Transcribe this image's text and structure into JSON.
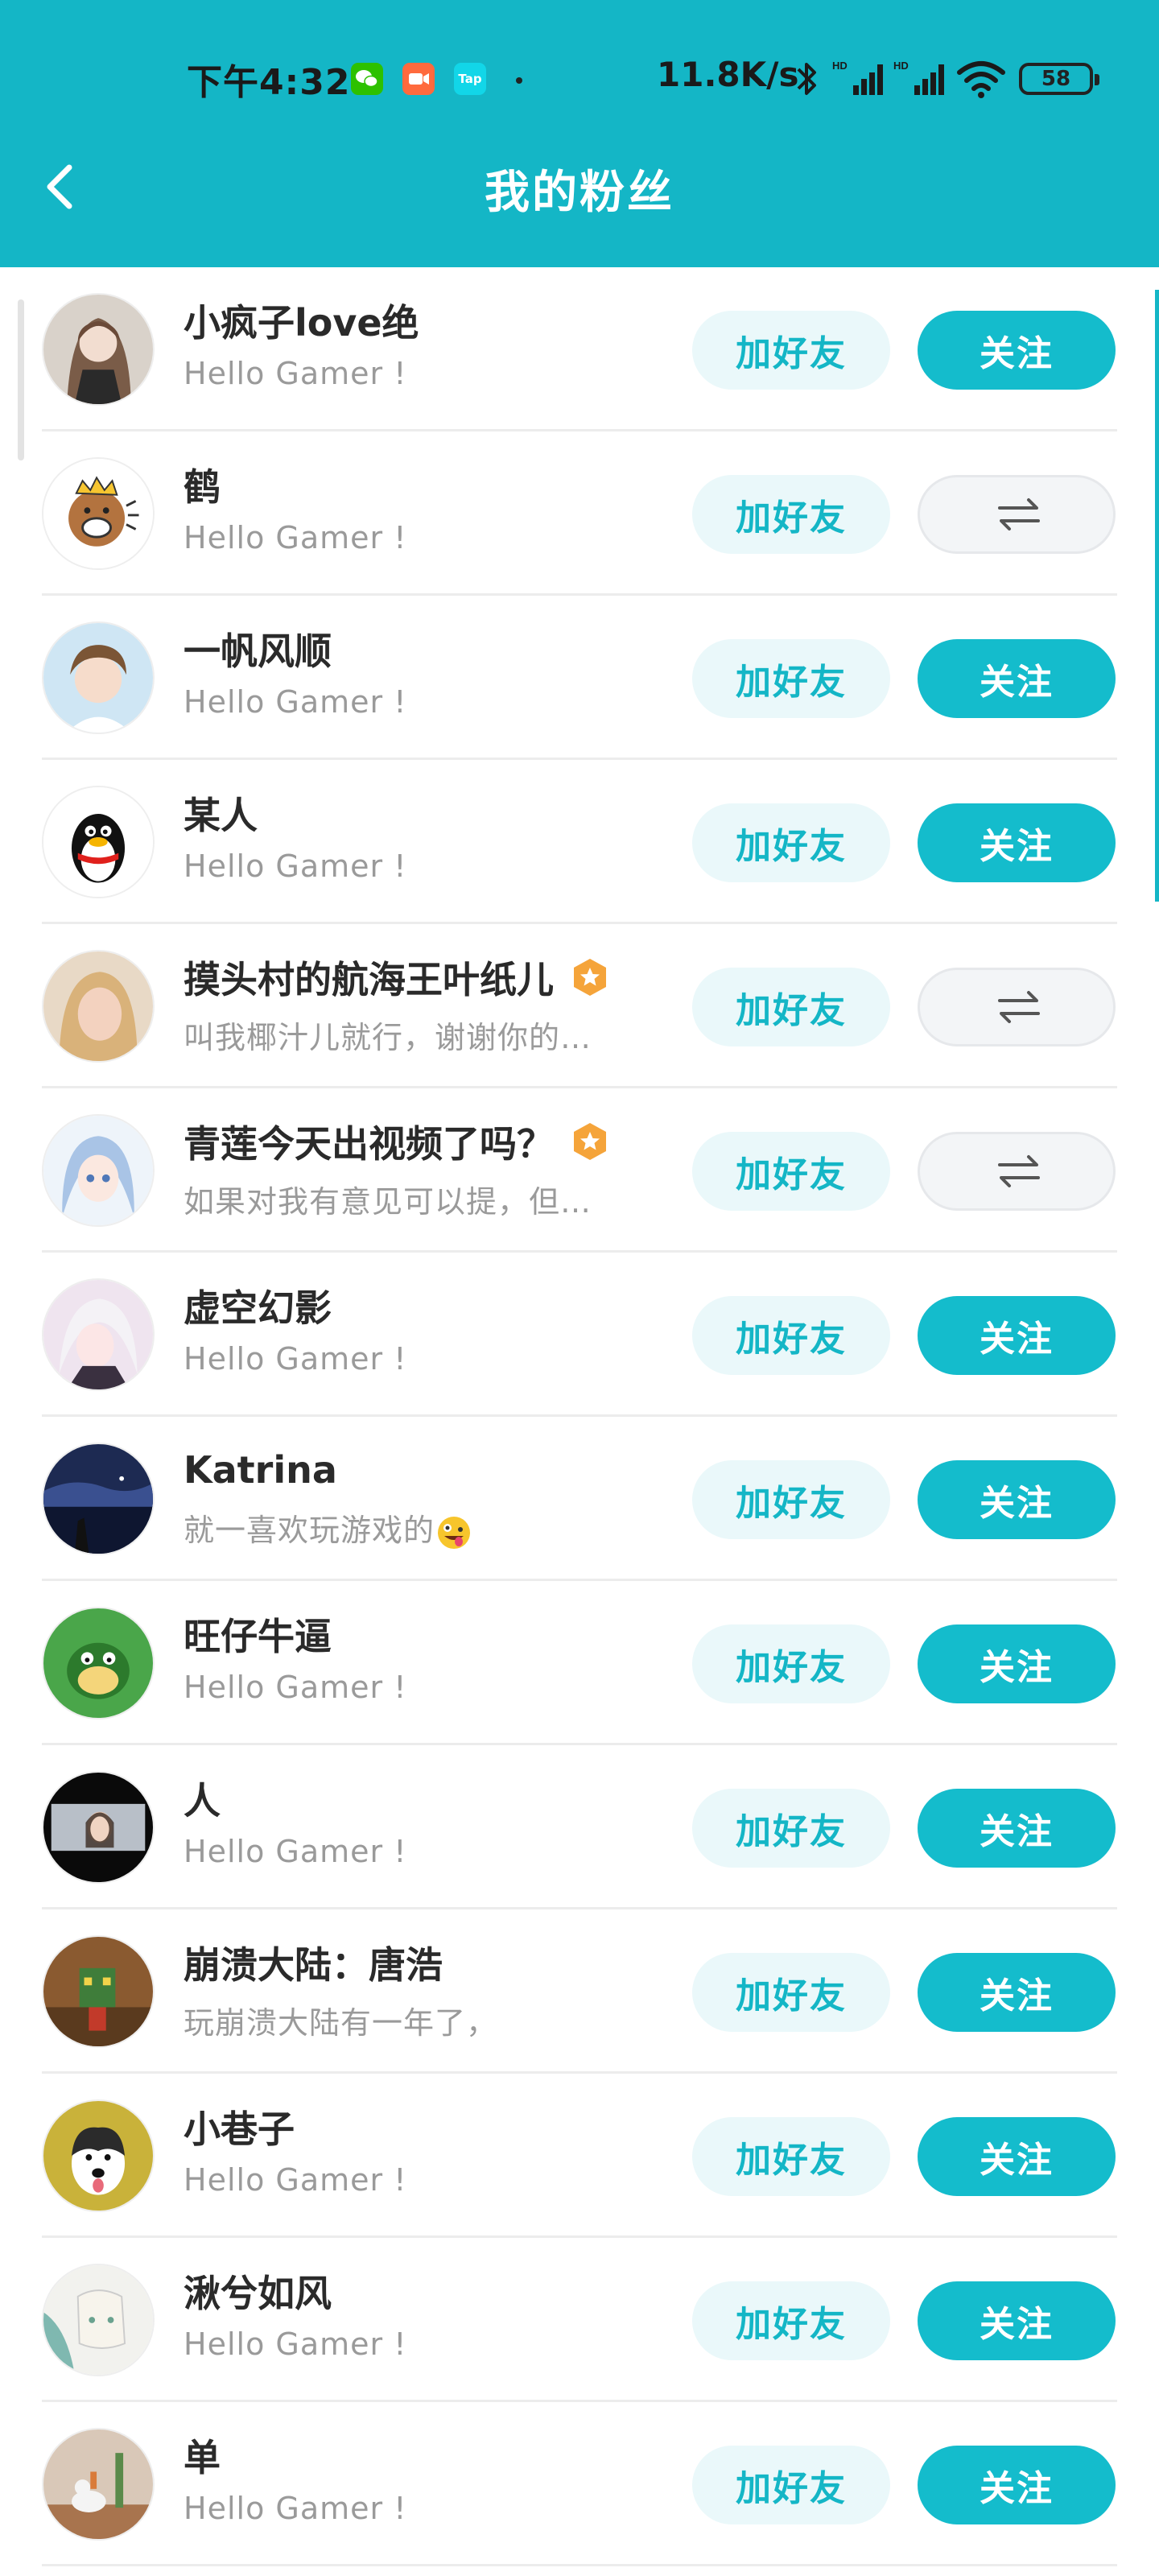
{
  "status_bar": {
    "time": "下午4:32",
    "net_speed": "11.8K/s",
    "battery": "58",
    "app_icons": [
      "wechat-icon",
      "video-icon",
      "taptap-icon"
    ],
    "tap_label": "Tap"
  },
  "header": {
    "title": "我的粉丝",
    "back_icon": "chevron-left-icon",
    "background": "#14b6c6"
  },
  "colors": {
    "accent": "#14bccc",
    "friend_bg": "#eaf8fa",
    "mutual_bg": "#f3f5f7",
    "badge": "#f5a43a"
  },
  "buttons": {
    "add_friend": "加好友",
    "follow": "关注",
    "mutual_icon": "swap-arrows-icon"
  },
  "fans": [
    {
      "name": "小疯子love绝",
      "bio": "Hello Gamer !",
      "state": "follow",
      "verified": false
    },
    {
      "name": "鹤",
      "bio": "Hello Gamer !",
      "state": "mutual",
      "verified": false
    },
    {
      "name": "一帆风顺",
      "bio": "Hello Gamer !",
      "state": "follow",
      "verified": false
    },
    {
      "name": "某人",
      "bio": "Hello Gamer !",
      "state": "follow",
      "verified": false
    },
    {
      "name": "摸头村的航海王叶纸儿",
      "bio": "叫我椰汁儿就行，谢谢你的…",
      "state": "mutual",
      "verified": true
    },
    {
      "name": "青莲今天出视频了吗？",
      "bio": "如果对我有意见可以提，但…",
      "state": "mutual",
      "verified": true
    },
    {
      "name": "虚空幻影",
      "bio": "Hello Gamer !",
      "state": "follow",
      "verified": false
    },
    {
      "name": "Katrina",
      "bio": "就一喜欢玩游戏的",
      "bio_emoji": "zany-face-emoji",
      "state": "follow",
      "verified": false
    },
    {
      "name": "旺仔牛逼",
      "bio": "Hello Gamer !",
      "state": "follow",
      "verified": false
    },
    {
      "name": "人",
      "bio": "Hello Gamer !",
      "state": "follow",
      "verified": false
    },
    {
      "name": "崩溃大陆：唐浩",
      "bio": "玩崩溃大陆有一年了，",
      "state": "follow",
      "verified": false
    },
    {
      "name": "小巷子",
      "bio": "Hello Gamer !",
      "state": "follow",
      "verified": false
    },
    {
      "name": "湫兮如风",
      "bio": "Hello Gamer !",
      "state": "follow",
      "verified": false
    },
    {
      "name": "单",
      "bio": "Hello Gamer !",
      "state": "follow",
      "verified": false
    }
  ]
}
